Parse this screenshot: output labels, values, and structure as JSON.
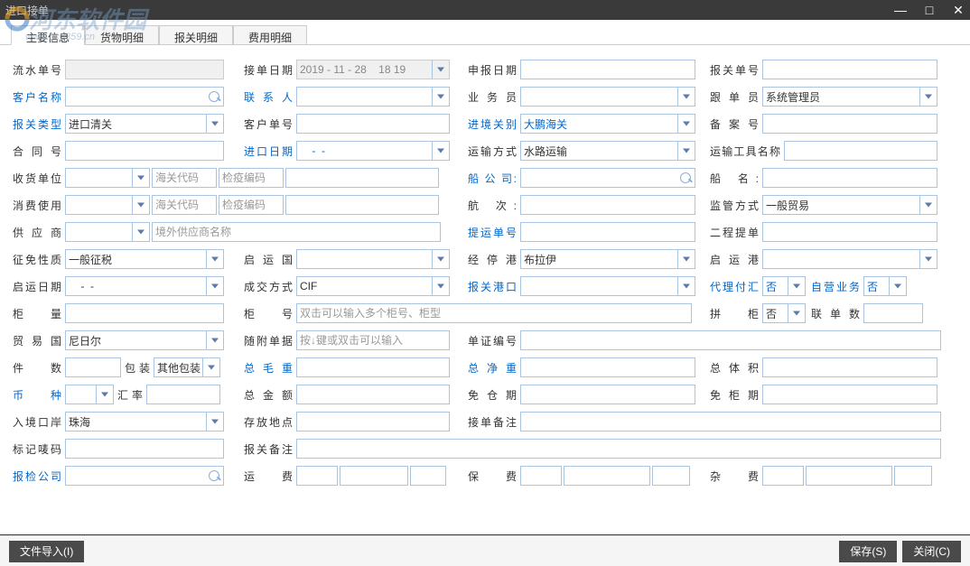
{
  "window": {
    "title": "进口接单"
  },
  "watermark": {
    "main": "河东软件园",
    "sub": "www.pc0359.cn"
  },
  "tabs": [
    "主要信息",
    "货物明细",
    "报关明细",
    "费用明细"
  ],
  "labels": {
    "r1c1": "流水单号",
    "r1c2": "接单日期",
    "r1c3": "申报日期",
    "r1c4": "报关单号",
    "r2c1": "客户名称",
    "r2c2": "联 系 人",
    "r2c3": "业 务 员",
    "r2c4": "跟 单 员",
    "r3c1": "报关类型",
    "r3c2": "客户单号",
    "r3c3": "进境关别",
    "r3c4": "备 案 号",
    "r4c1": "合 同 号",
    "r4c2": "进口日期",
    "r4c3": "运输方式",
    "r4c4": "运输工具名称",
    "r5c1": "收货单位",
    "r5c2a": "海关代码",
    "r5c2b": "检疫编码",
    "r5c3": "船 公 司:",
    "r5c4": "船    名:",
    "r6c1": "消费使用",
    "r6c2a": "海关代码",
    "r6c2b": "检疫编码",
    "r6c3": "航    次:",
    "r6c4": "监管方式",
    "r7c1": "供 应 商",
    "r7c2": "境外供应商名称",
    "r7c3": "提运单号",
    "r7c4": "二程提单",
    "r8c1": "征免性质",
    "r8c2": "启 运 国",
    "r8c3": "经 停 港",
    "r8c4": "启 运 港",
    "r9c1": "启运日期",
    "r9c2": "成交方式",
    "r9c3": "报关港口",
    "r9c4a": "代理付汇",
    "r9c4b": "自营业务",
    "r10c1": "柜    量",
    "r10c2": "柜    号",
    "r10c4a": "拼    柜",
    "r10c4b": "联 单 数",
    "r11c1": "贸 易 国",
    "r11c2": "随附单据",
    "r11c3": "单证编号",
    "r12c1": "件    数",
    "r12c1b": "包装",
    "r12c2": "总 毛 重",
    "r12c3": "总 净 重",
    "r12c4": "总 体 积",
    "r13c1": "币    种",
    "r13c1b": "汇率",
    "r13c2": "总 金 额",
    "r13c3": "免 仓 期",
    "r13c4": "免 柜 期",
    "r14c1": "入境口岸",
    "r14c2": "存放地点",
    "r14c3": "接单备注",
    "r15c1": "标记唛码",
    "r15c2": "报关备注",
    "r16c1": "报检公司",
    "r16c2": "运    费",
    "r16c3": "保    费",
    "r16c4": "杂    费"
  },
  "values": {
    "accept_date": "2019 - 11 - 28    18 19",
    "follower": "系统管理员",
    "customs_type": "进口清关",
    "entry_customs": "大鹏海关",
    "import_date": "    -  -",
    "transport_mode": "水路运输",
    "supervision": "一般贸易",
    "levy": "一般征税",
    "stop_port": "布拉伊",
    "depart_date": "    -  -",
    "trade_term": "CIF",
    "agent_pay": "否",
    "self_biz": "否",
    "combine": "否",
    "trade_country": "尼日尔",
    "packing": "其他包装",
    "entry_port": "珠海",
    "container_ph": "双击可以输入多个柜号、柜型",
    "attach_ph": "按↓键或双击可以输入"
  },
  "buttons": {
    "import": "文件导入(I)",
    "save": "保存(S)",
    "close": "关闭(C)"
  }
}
